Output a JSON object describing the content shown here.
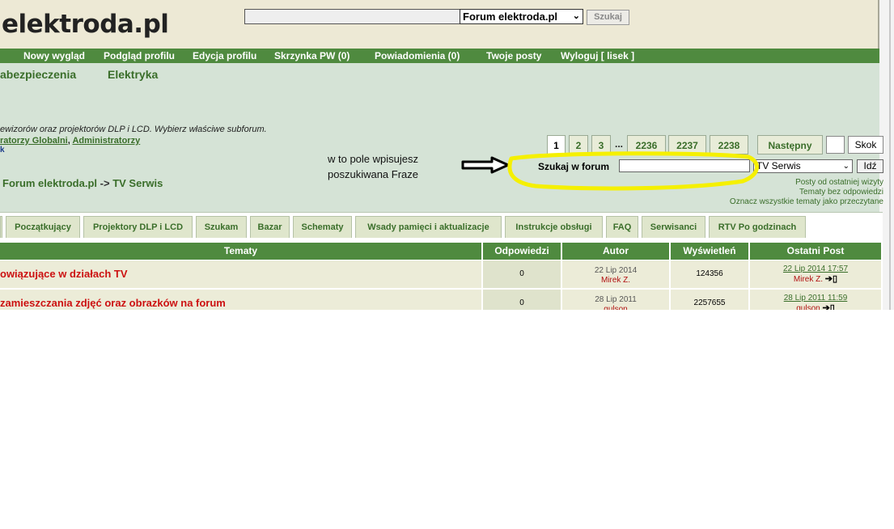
{
  "header": {
    "logo": "elektroda.pl",
    "search_placeholder": "",
    "scope": "Forum elektroda.pl",
    "search_button": "Szukaj"
  },
  "nav": [
    "Nowy wygląd",
    "Podgląd profilu",
    "Edycja profilu",
    "Skrzynka PW (0)",
    "Powiadomienia (0)",
    "Twoje posty",
    "Wyloguj [ lisek ]"
  ],
  "categories": [
    "abezpieczenia",
    "Elektryka"
  ],
  "forum": {
    "description": "ewizorów oraz projektorów DLP i LCD. Wybierz właściwe subforum.",
    "moderators_1": "ratorzy Globalni",
    "moderators_sep": ", ",
    "moderators_2": "Administratorzy",
    "moderators_tail": "k"
  },
  "annotation": {
    "line1": "w to pole wpisujesz",
    "line2": "poszukiwana Fraze"
  },
  "pagination": {
    "pages": [
      "1",
      "2",
      "3",
      "2236",
      "2237",
      "2238"
    ],
    "ellipsis": "...",
    "next": "Następny",
    "jump_button": "Skok"
  },
  "forum_search": {
    "label": "Szukaj w forum",
    "value": "",
    "scope": "TV Serwis",
    "button": "Idź"
  },
  "breadcrumb": {
    "root": "Forum elektroda.pl",
    "sep": "->",
    "current": "TV Serwis"
  },
  "links": [
    "Posty od ostatniej wizyty",
    "Tematy bez odpowiedzi",
    "Oznacz wszystkie tematy jako przeczytane"
  ],
  "tabs": [
    "Początkujący",
    "Projektory DLP i LCD",
    "Szukam",
    "Bazar",
    "Schematy",
    "Wsady pamięci i aktualizacje",
    "Instrukcje obsługi",
    "FAQ",
    "Serwisanci",
    "RTV Po godzinach"
  ],
  "table": {
    "headers": [
      "Tematy",
      "Odpowiedzi",
      "Autor",
      "Wyświetleń",
      "Ostatni Post"
    ],
    "rows": [
      {
        "title": "owiązujące w działach TV",
        "replies": "0",
        "date": "22 Lip 2014",
        "author": "Mirek Z.",
        "views": "124356",
        "last_date": "22 Lip 2014 17:57",
        "last_user": "Mirek Z."
      },
      {
        "title": " zamieszczania zdjęć oraz obrazków na forum",
        "replies": "0",
        "date": "28 Lip 2011",
        "author": "gulson",
        "views": "2257655",
        "last_date": "28 Lip 2011 11:59",
        "last_user": "gulson"
      }
    ]
  },
  "colors": {
    "nav_green": "#4f8a3f",
    "page_bg": "#d5e3d6",
    "header_bg": "#ede9d5",
    "title_red": "#cc1111",
    "highlight_yellow": "#f5f000"
  }
}
